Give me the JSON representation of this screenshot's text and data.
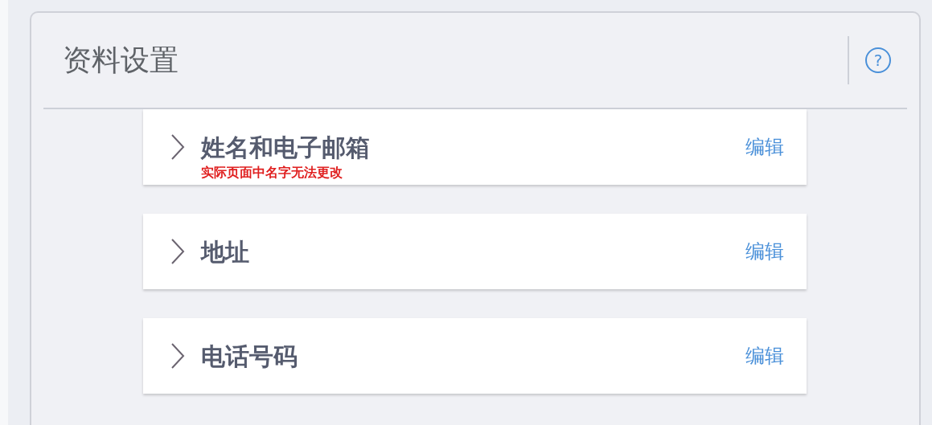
{
  "header": {
    "title": "资料设置",
    "help_icon_text": "?"
  },
  "sections": [
    {
      "title": "姓名和电子邮箱",
      "note": "实际页面中名字无法更改",
      "action": "编辑",
      "expanded": false
    },
    {
      "title": "地址",
      "action": "编辑",
      "expanded": false
    },
    {
      "title": "电话号码",
      "action": "编辑",
      "expanded": false
    }
  ]
}
